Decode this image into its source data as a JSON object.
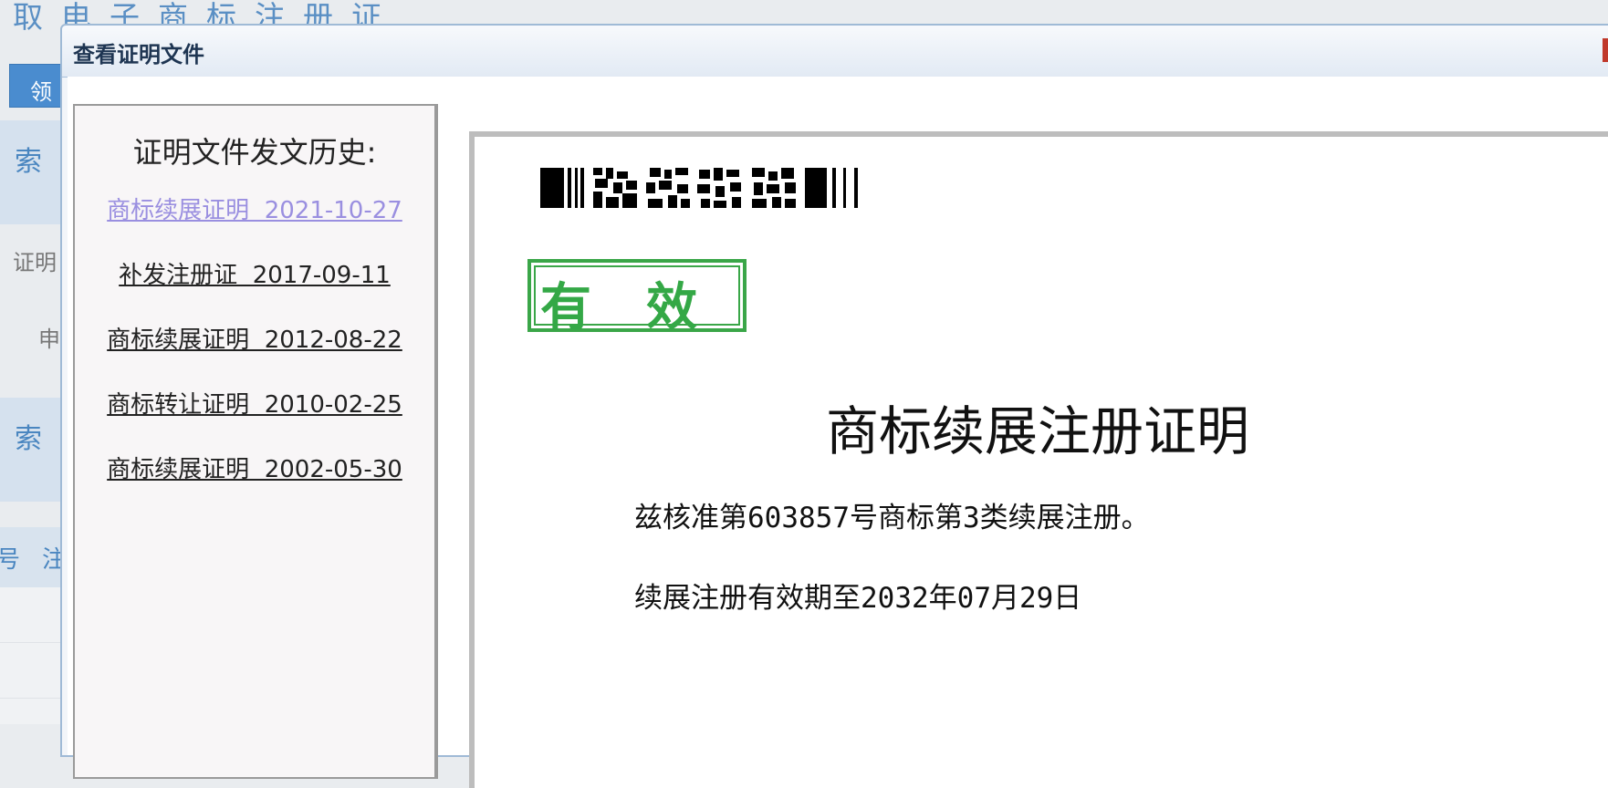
{
  "background": {
    "page_title": "取电子商标注册证",
    "button_label": "领",
    "search_label_1": "索",
    "field_label_1": "证明",
    "field_label_2": "申",
    "search_label_2": "索",
    "column_1": "号",
    "column_2": "注"
  },
  "dialog": {
    "title": "查看证明文件",
    "history_title": "证明文件发文历史:",
    "history": [
      {
        "label": "商标续展证明  2021-10-27"
      },
      {
        "label": "补发注册证  2017-09-11"
      },
      {
        "label": "商标续展证明  2012-08-22"
      },
      {
        "label": "商标转让证明  2010-02-25"
      },
      {
        "label": "商标续展证明  2002-05-30"
      }
    ]
  },
  "certificate": {
    "stamp_text": "有效",
    "title": "商标续展注册证明",
    "line1": "兹核准第603857号商标第3类续展注册。",
    "line2": "续展注册有效期至2032年07月29日"
  },
  "colors": {
    "stamp_green": "#34a846",
    "visited_link": "#9a8fe0",
    "header_blue": "#5a8fc4"
  }
}
